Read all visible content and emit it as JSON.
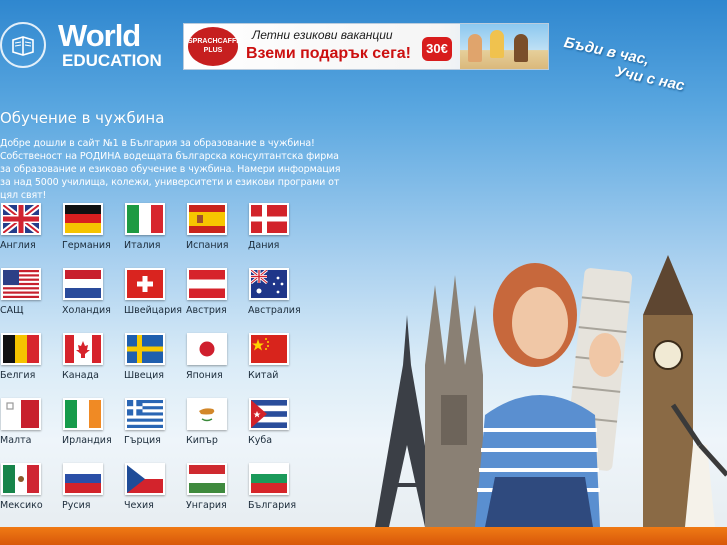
{
  "header": {
    "logo_world": "World",
    "logo_education": "EDUCATION",
    "banner": {
      "brand": "SPRACHCAFFE PLUS",
      "line1": "Летни езикови ваканции",
      "line2": "Вземи подарък сега!",
      "price": "30€"
    },
    "slogan_line1": "Бъди в час,",
    "slogan_line2": "Учи с нас"
  },
  "main": {
    "title": "Обучение в чужбина",
    "intro": "Добре дошли в сайт №1 в България за образование в чужбина! Собственост на РОДИНА водещата българска консултантска фирма за образование и езиково обучение в чужбина. Намери информация за над 5000 училища, колежи, университети и езикови програми от цял свят!"
  },
  "countries": [
    {
      "label": "Англия",
      "icon": "flag-uk-icon"
    },
    {
      "label": "Германия",
      "icon": "flag-germany-icon"
    },
    {
      "label": "Италия",
      "icon": "flag-italy-icon"
    },
    {
      "label": "Испания",
      "icon": "flag-spain-icon"
    },
    {
      "label": "Дания",
      "icon": "flag-denmark-icon"
    },
    {
      "label": "САЩ",
      "icon": "flag-usa-icon"
    },
    {
      "label": "Холандия",
      "icon": "flag-netherlands-icon"
    },
    {
      "label": "Швейцария",
      "icon": "flag-switzerland-icon"
    },
    {
      "label": "Австрия",
      "icon": "flag-austria-icon"
    },
    {
      "label": "Австралия",
      "icon": "flag-australia-icon"
    },
    {
      "label": "Белгия",
      "icon": "flag-belgium-icon"
    },
    {
      "label": "Канада",
      "icon": "flag-canada-icon"
    },
    {
      "label": "Швеция",
      "icon": "flag-sweden-icon"
    },
    {
      "label": "Япония",
      "icon": "flag-japan-icon"
    },
    {
      "label": "Китай",
      "icon": "flag-china-icon"
    },
    {
      "label": "Малта",
      "icon": "flag-malta-icon"
    },
    {
      "label": "Ирландия",
      "icon": "flag-ireland-icon"
    },
    {
      "label": "Гърция",
      "icon": "flag-greece-icon"
    },
    {
      "label": "Кипър",
      "icon": "flag-cyprus-icon"
    },
    {
      "label": "Куба",
      "icon": "flag-cuba-icon"
    },
    {
      "label": "Мексико",
      "icon": "flag-mexico-icon"
    },
    {
      "label": "Русия",
      "icon": "flag-russia-icon"
    },
    {
      "label": "Чехия",
      "icon": "flag-czech-icon"
    },
    {
      "label": "Унгария",
      "icon": "flag-hungary-icon"
    },
    {
      "label": "България",
      "icon": "flag-bulgaria-icon"
    }
  ],
  "colors": {
    "accent_orange": "#e8650f",
    "banner_red": "#cc1010",
    "sky_blue": "#2f87cf"
  }
}
